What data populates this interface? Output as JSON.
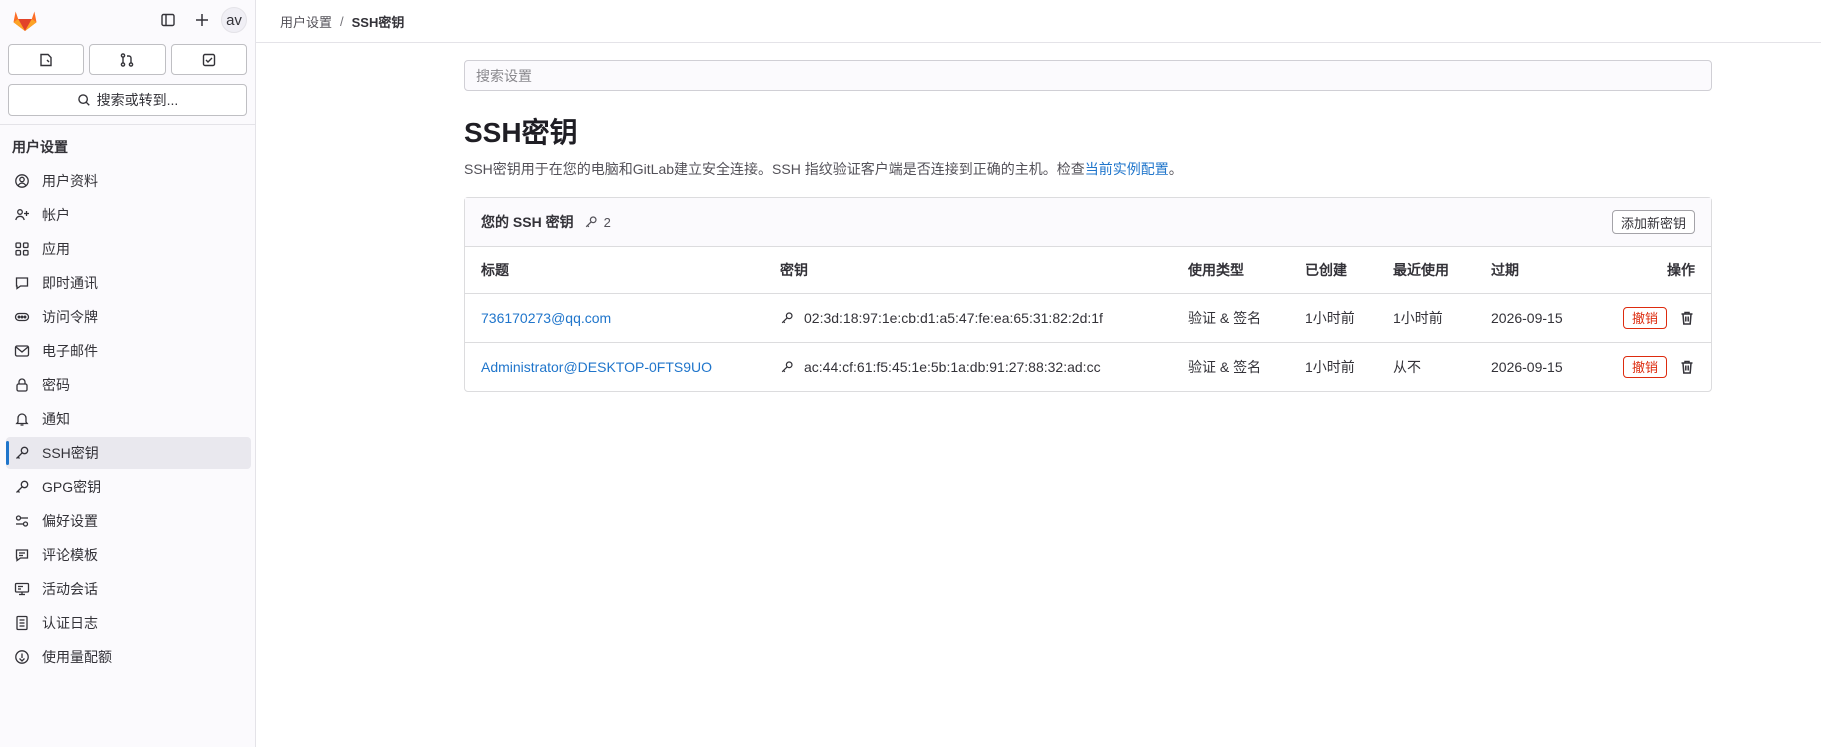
{
  "sidebar": {
    "avatar_initials": "av",
    "search_label": "搜索或转到...",
    "section_title": "用户设置",
    "items": [
      {
        "label": "用户资料",
        "icon": "profile-icon"
      },
      {
        "label": "帐户",
        "icon": "account-icon"
      },
      {
        "label": "应用",
        "icon": "applications-icon"
      },
      {
        "label": "即时通讯",
        "icon": "chat-icon"
      },
      {
        "label": "访问令牌",
        "icon": "token-icon"
      },
      {
        "label": "电子邮件",
        "icon": "mail-icon"
      },
      {
        "label": "密码",
        "icon": "lock-icon"
      },
      {
        "label": "通知",
        "icon": "bell-icon"
      },
      {
        "label": "SSH密钥",
        "icon": "key-icon",
        "active": true
      },
      {
        "label": "GPG密钥",
        "icon": "key-icon"
      },
      {
        "label": "偏好设置",
        "icon": "preferences-icon"
      },
      {
        "label": "评论模板",
        "icon": "comment-template-icon"
      },
      {
        "label": "活动会话",
        "icon": "monitor-icon"
      },
      {
        "label": "认证日志",
        "icon": "log-icon"
      },
      {
        "label": "使用量配额",
        "icon": "quota-icon"
      }
    ]
  },
  "breadcrumb": {
    "parent": "用户设置",
    "separator": "/",
    "current": "SSH密钥"
  },
  "search": {
    "placeholder": "搜索设置"
  },
  "page": {
    "title": "SSH密钥",
    "description_prefix": "SSH密钥用于在您的电脑和GitLab建立安全连接。SSH 指纹验证客户端是否连接到正确的主机。检查",
    "description_link": "当前实例配置",
    "description_suffix": "。"
  },
  "keys_card": {
    "title": "您的 SSH 密钥",
    "count": "2",
    "add_button": "添加新密钥",
    "columns": {
      "title": "标题",
      "key": "密钥",
      "usage": "使用类型",
      "created": "已创建",
      "last_used": "最近使用",
      "expires": "过期",
      "actions": "操作"
    },
    "rows": [
      {
        "title": "736170273@qq.com",
        "fingerprint": "02:3d:18:97:1e:cb:d1:a5:47:fe:ea:65:31:82:2d:1f",
        "usage": "验证 & 签名",
        "created": "1小时前",
        "last_used": "1小时前",
        "expires": "2026-09-15",
        "revoke": "撤销"
      },
      {
        "title": "Administrator@DESKTOP-0FTS9UO",
        "fingerprint": "ac:44:cf:61:f5:45:1e:5b:1a:db:91:27:88:32:ad:cc",
        "usage": "验证 & 签名",
        "created": "1小时前",
        "last_used": "从不",
        "expires": "2026-09-15",
        "revoke": "撤销"
      }
    ]
  },
  "colors": {
    "link": "#1f75cb",
    "danger": "#dd2b0e",
    "active_indicator": "#1f75cb",
    "logo_orange": "#e24329"
  }
}
